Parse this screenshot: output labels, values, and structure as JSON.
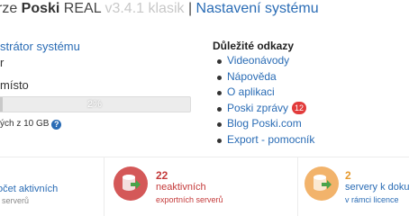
{
  "header": {
    "title_prefix": "rze ",
    "brand": "Poski",
    "product": " REAL ",
    "version": "v3.4.1 klasik",
    "separator": " | ",
    "settings_link": "Nastavení systému"
  },
  "left": {
    "role_link": "strátor systému",
    "user": "r",
    "space_label": "místo",
    "progress_percent": 2,
    "progress_label": "2%",
    "usage_text": "ých z 10 GB",
    "help_glyph": "?"
  },
  "links": {
    "heading": "Důležité odkazy",
    "items": [
      {
        "label": "Videonávody"
      },
      {
        "label": "Nápověda"
      },
      {
        "label": "O aplikaci"
      },
      {
        "label": "Poski zprávy",
        "badge": "12"
      },
      {
        "label": "Blog Poski.com"
      },
      {
        "label": "Export - pomocník"
      }
    ]
  },
  "tiles": {
    "active": {
      "line1": "očet aktivních",
      "line2": "serverů"
    },
    "inactive": {
      "count": "22",
      "line1": "neaktivních",
      "line2": "exportních serverů",
      "icon": "database-arrow-icon",
      "color": "#d45858"
    },
    "limit": {
      "count": "2",
      "line1": "servery k doku",
      "line2": "v rámci licence",
      "icon": "database-arrow-icon",
      "color": "#f2b36b"
    }
  }
}
